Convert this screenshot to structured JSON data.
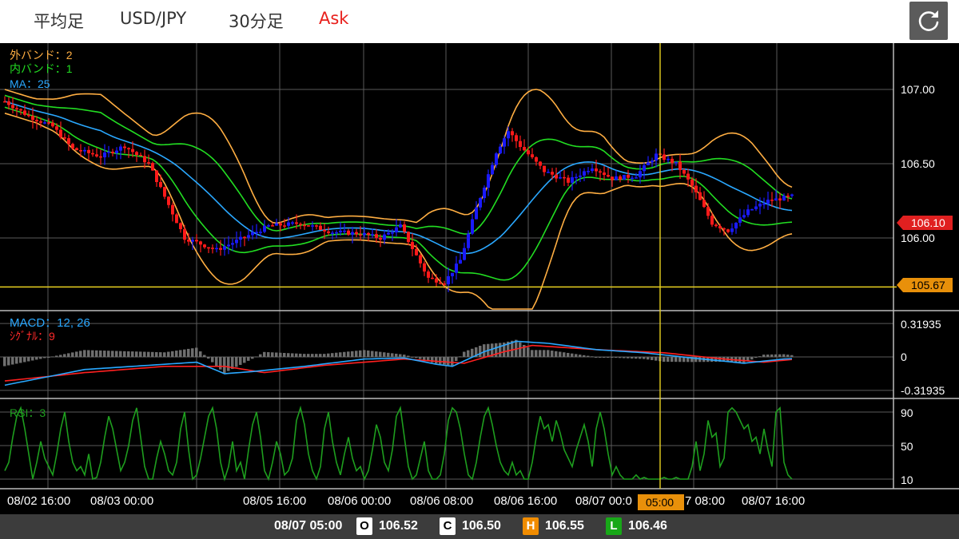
{
  "toolbar": {
    "chart_type": "平均足",
    "symbol": "USD/JPY",
    "timeframe": "30分足",
    "price_side": "Ask",
    "refresh_icon": "refresh-icon"
  },
  "colors": {
    "background": "#000000",
    "grid": "#5a5a5a",
    "bullish": "#1a1aff",
    "bearish": "#ff1a1a",
    "outer_band": "#ffae42",
    "inner_band": "#22dd22",
    "ma": "#2aa8ff",
    "crosshair": "#e8d020",
    "rsi": "#1e9e1e",
    "current_price": "#e02020",
    "crosshair_price": "#e8900a"
  },
  "chart_data": [
    {
      "type": "candlestick",
      "panel": "price",
      "indicators": [
        {
          "label": "外バンド：2",
          "color": "#ffae42"
        },
        {
          "label": "内バンド：1",
          "color": "#22dd22"
        },
        {
          "label": "MA：25",
          "color": "#2aa8ff"
        }
      ],
      "y_ticks": [
        "107.00",
        "106.50",
        "106.00"
      ],
      "ylim": [
        105.5,
        107.3
      ],
      "current_price": "106.10",
      "crosshair_price": "105.67",
      "key_points": [
        {
          "idx": 0,
          "close": 106.92
        },
        {
          "idx": 6,
          "close": 106.82
        },
        {
          "idx": 12,
          "close": 106.75
        },
        {
          "idx": 17,
          "close": 106.6
        },
        {
          "idx": 24,
          "close": 106.55
        },
        {
          "idx": 30,
          "close": 106.62
        },
        {
          "idx": 36,
          "close": 106.5
        },
        {
          "idx": 45,
          "close": 106.0
        },
        {
          "idx": 53,
          "close": 105.92
        },
        {
          "idx": 58,
          "close": 105.98
        },
        {
          "idx": 66,
          "close": 106.08
        },
        {
          "idx": 74,
          "close": 106.1
        },
        {
          "idx": 82,
          "close": 106.04
        },
        {
          "idx": 89,
          "close": 106.03
        },
        {
          "idx": 94,
          "close": 106.0
        },
        {
          "idx": 99,
          "close": 106.08
        },
        {
          "idx": 106,
          "close": 105.73
        },
        {
          "idx": 110,
          "close": 105.7
        },
        {
          "idx": 114,
          "close": 105.85
        },
        {
          "idx": 118,
          "close": 106.2
        },
        {
          "idx": 123,
          "close": 106.58
        },
        {
          "idx": 126,
          "close": 106.72
        },
        {
          "idx": 129,
          "close": 106.62
        },
        {
          "idx": 135,
          "close": 106.45
        },
        {
          "idx": 141,
          "close": 106.38
        },
        {
          "idx": 147,
          "close": 106.48
        },
        {
          "idx": 152,
          "close": 106.4
        },
        {
          "idx": 158,
          "close": 106.42
        },
        {
          "idx": 163,
          "close": 106.56
        },
        {
          "idx": 168,
          "close": 106.5
        },
        {
          "idx": 172,
          "close": 106.35
        },
        {
          "idx": 177,
          "close": 106.1
        },
        {
          "idx": 181,
          "close": 106.05
        },
        {
          "idx": 186,
          "close": 106.18
        },
        {
          "idx": 191,
          "close": 106.25
        },
        {
          "idx": 197,
          "close": 106.28
        },
        {
          "idx": 201,
          "close": 106.1
        }
      ]
    },
    {
      "type": "line",
      "panel": "macd",
      "title": "MACD：12, 26",
      "signal_label": "ｼｸﾞﾅﾙ：9",
      "y_ticks": [
        "0.31935",
        "0",
        "-0.31935"
      ],
      "ylim": [
        -0.4,
        0.4
      ],
      "macd_points": [
        {
          "idx": 0,
          "v": -0.27
        },
        {
          "idx": 20,
          "v": -0.12
        },
        {
          "idx": 40,
          "v": -0.07
        },
        {
          "idx": 48,
          "v": -0.05
        },
        {
          "idx": 55,
          "v": -0.16
        },
        {
          "idx": 62,
          "v": -0.14
        },
        {
          "idx": 75,
          "v": -0.09
        },
        {
          "idx": 90,
          "v": -0.02
        },
        {
          "idx": 100,
          "v": -0.01
        },
        {
          "idx": 108,
          "v": -0.07
        },
        {
          "idx": 112,
          "v": -0.09
        },
        {
          "idx": 120,
          "v": 0.05
        },
        {
          "idx": 128,
          "v": 0.15
        },
        {
          "idx": 136,
          "v": 0.13
        },
        {
          "idx": 148,
          "v": 0.07
        },
        {
          "idx": 160,
          "v": 0.04
        },
        {
          "idx": 172,
          "v": -0.01
        },
        {
          "idx": 185,
          "v": -0.06
        },
        {
          "idx": 195,
          "v": -0.02
        },
        {
          "idx": 201,
          "v": -0.01
        }
      ],
      "signal_points": [
        {
          "idx": 0,
          "v": -0.23
        },
        {
          "idx": 20,
          "v": -0.15
        },
        {
          "idx": 40,
          "v": -0.09
        },
        {
          "idx": 55,
          "v": -0.09
        },
        {
          "idx": 65,
          "v": -0.15
        },
        {
          "idx": 80,
          "v": -0.08
        },
        {
          "idx": 100,
          "v": -0.02
        },
        {
          "idx": 115,
          "v": -0.06
        },
        {
          "idx": 125,
          "v": 0.05
        },
        {
          "idx": 132,
          "v": 0.11
        },
        {
          "idx": 148,
          "v": 0.07
        },
        {
          "idx": 165,
          "v": 0.04
        },
        {
          "idx": 180,
          "v": -0.02
        },
        {
          "idx": 190,
          "v": -0.05
        },
        {
          "idx": 201,
          "v": -0.01
        }
      ]
    },
    {
      "type": "line",
      "panel": "rsi",
      "title": "RSI：3",
      "y_ticks": [
        "90",
        "50",
        "10"
      ],
      "ylim": [
        0,
        100
      ],
      "rsi_values": [
        20,
        30,
        60,
        85,
        95,
        70,
        40,
        10,
        30,
        55,
        35,
        25,
        15,
        40,
        70,
        90,
        55,
        30,
        20,
        25,
        15,
        40,
        10,
        12,
        30,
        60,
        85,
        70,
        45,
        20,
        30,
        50,
        80,
        95,
        60,
        25,
        10,
        10,
        35,
        55,
        40,
        20,
        15,
        30,
        70,
        90,
        45,
        10,
        15,
        35,
        60,
        85,
        95,
        70,
        30,
        10,
        25,
        55,
        20,
        30,
        10,
        45,
        75,
        90,
        60,
        20,
        10,
        30,
        55,
        40,
        15,
        20,
        35,
        80,
        95,
        75,
        40,
        20,
        10,
        25,
        70,
        90,
        55,
        30,
        15,
        40,
        60,
        35,
        20,
        25,
        10,
        20,
        45,
        75,
        60,
        30,
        20,
        45,
        85,
        95,
        60,
        25,
        10,
        15,
        35,
        55,
        20,
        10,
        10,
        15,
        40,
        80,
        95,
        90,
        70,
        40,
        15,
        10,
        30,
        60,
        85,
        95,
        75,
        50,
        30,
        20,
        15,
        30,
        15,
        20,
        10,
        10,
        30,
        60,
        85,
        70,
        75,
        55,
        80,
        65,
        45,
        35,
        25,
        45,
        60,
        75,
        55,
        25,
        70,
        90,
        70,
        40,
        15,
        25,
        15,
        10,
        10,
        10,
        15,
        10,
        12,
        10,
        10,
        10,
        10,
        12,
        10,
        10,
        12,
        10,
        10,
        10,
        25,
        55,
        20,
        40,
        80,
        60,
        65,
        25,
        35,
        90,
        95,
        90,
        80,
        70,
        75,
        55,
        60,
        40,
        70,
        45,
        25,
        90,
        95,
        30,
        15,
        10
      ]
    }
  ],
  "x_labels": [
    "08/02 16:00",
    "08/03 00:00",
    "08/05 16:00",
    "08/06 00:00",
    "08/06 08:00",
    "08/06 16:00",
    "08/07 00:0",
    "7 08:00",
    "08/07 16:00"
  ],
  "crosshair_time": "05:00",
  "ohlc": {
    "datetime": "08/07 05:00",
    "o_key": "O",
    "o": "106.52",
    "c_key": "C",
    "c": "106.50",
    "h_key": "H",
    "h": "106.55",
    "l_key": "L",
    "l": "106.46"
  }
}
